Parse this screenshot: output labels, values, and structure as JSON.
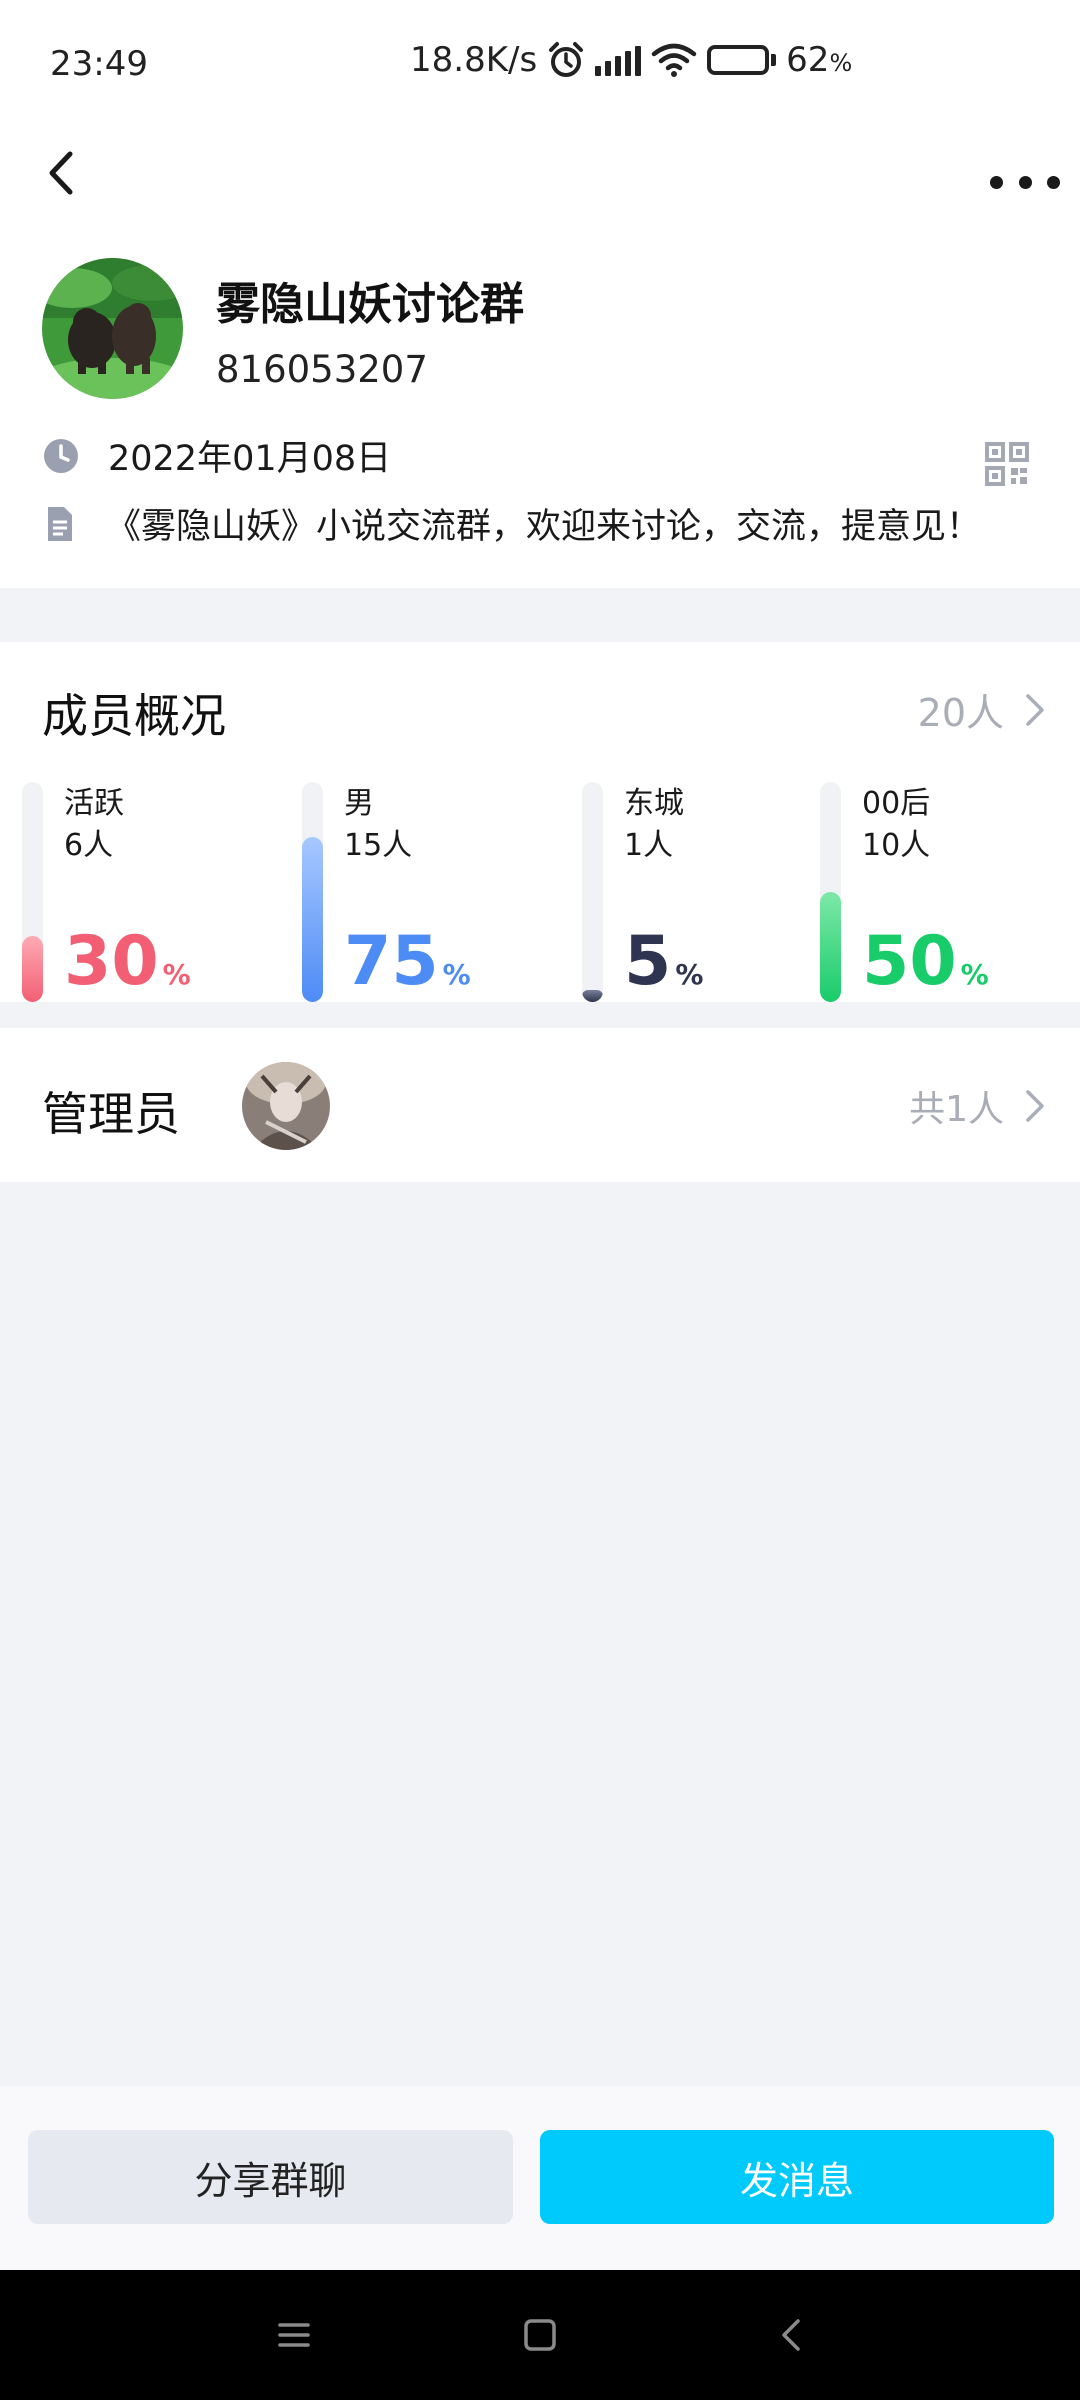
{
  "status_bar": {
    "time": "23:49",
    "net_speed": "18.8K/s",
    "battery_pct": "62",
    "battery_unit": "%",
    "battery_level": 0.62,
    "icons": [
      "alarm-icon",
      "signal-icon",
      "wifi-icon",
      "battery-icon"
    ]
  },
  "header": {
    "back_icon": "back-arrow-icon",
    "more_icon": "more-dots-icon"
  },
  "group": {
    "name": "雾隐山妖讨论群",
    "id": "816053207",
    "created_date": "2022年01月08日",
    "description": "《雾隐山妖》小说交流群，欢迎来讨论，交流，提意见！"
  },
  "members": {
    "title": "成员概况",
    "count": "20人",
    "stats": [
      {
        "label": "活跃",
        "count": "6人",
        "percent": "30",
        "value": 0.3,
        "color": "#f25f74",
        "color_light": "#ffaab4"
      },
      {
        "label": "男",
        "count": "15人",
        "percent": "75",
        "value": 0.75,
        "color": "#4d8bf5",
        "color_light": "#a8c8ff"
      },
      {
        "label": "东城",
        "count": "1人",
        "percent": "5",
        "value": 0.05,
        "color": "#2f3550",
        "color_light": "#7a8098"
      },
      {
        "label": "00后",
        "count": "10人",
        "percent": "50",
        "value": 0.5,
        "color": "#19cc6a",
        "color_light": "#7ee8a8"
      }
    ],
    "percent_unit": "%"
  },
  "admins": {
    "title": "管理员",
    "count": "共1人"
  },
  "actions": {
    "share_label": "分享群聊",
    "send_label": "发消息"
  },
  "colors": {
    "accent": "#00cafc",
    "secondary_text": "#a9adb6"
  }
}
